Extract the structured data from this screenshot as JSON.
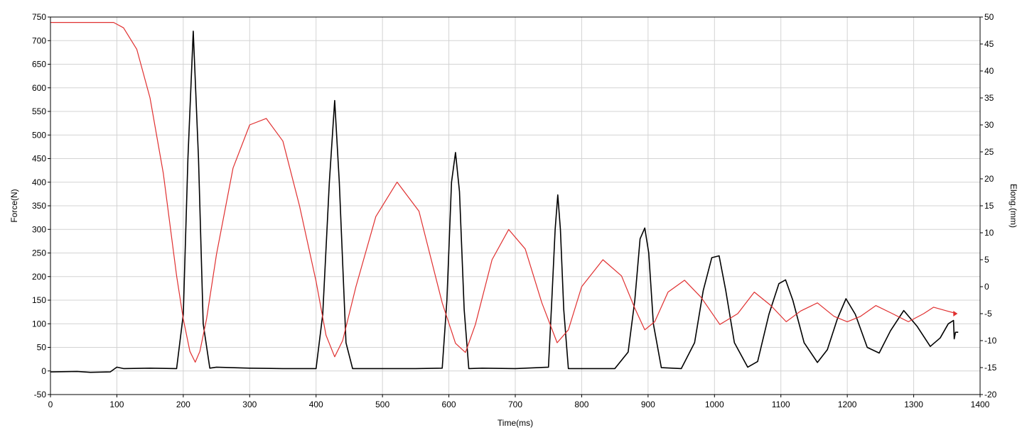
{
  "chart_data": {
    "type": "line",
    "xlabel": "Time(ms)",
    "ylabel_left": "Force(N)",
    "ylabel_right": "Elong.(mm)",
    "xlim": [
      0,
      1400
    ],
    "ylim_left": [
      -50,
      750
    ],
    "ylim_right": [
      -20,
      50
    ],
    "x_ticks": [
      0,
      100,
      200,
      300,
      400,
      500,
      600,
      700,
      800,
      900,
      1000,
      1100,
      1200,
      1300,
      1400
    ],
    "y_left_ticks": [
      -50,
      0,
      50,
      100,
      150,
      200,
      250,
      300,
      350,
      400,
      450,
      500,
      550,
      600,
      650,
      700,
      750
    ],
    "y_right_ticks": [
      -20,
      -15,
      -10,
      -5,
      0,
      5,
      10,
      15,
      20,
      25,
      30,
      35,
      40,
      45,
      50
    ],
    "grid": true,
    "legend": "none",
    "series": [
      {
        "axis": "left",
        "color": "#000000",
        "x": [
          0,
          40,
          60,
          90,
          100,
          110,
          150,
          190,
          200,
          207,
          215,
          223,
          230,
          240,
          250,
          300,
          350,
          400,
          410,
          420,
          428,
          435,
          445,
          455,
          500,
          550,
          590,
          597,
          604,
          610,
          616,
          623,
          630,
          650,
          700,
          750,
          755,
          760,
          764,
          768,
          773,
          780,
          800,
          850,
          870,
          880,
          888,
          895,
          901,
          908,
          920,
          950,
          970,
          983,
          996,
          1007,
          1017,
          1030,
          1050,
          1065,
          1082,
          1097,
          1107,
          1118,
          1135,
          1155,
          1170,
          1185,
          1198,
          1212,
          1230,
          1248,
          1265,
          1285,
          1305,
          1325,
          1340,
          1352,
          1360,
          1361,
          1363,
          1367
        ],
        "y": [
          -2,
          -1,
          -3,
          -2,
          8,
          5,
          6,
          5,
          120,
          450,
          720,
          450,
          100,
          6,
          8,
          6,
          5,
          5,
          120,
          400,
          573,
          400,
          60,
          5,
          5,
          5,
          6,
          150,
          400,
          463,
          380,
          130,
          5,
          6,
          5,
          8,
          150,
          300,
          373,
          300,
          130,
          5,
          5,
          5,
          40,
          150,
          280,
          303,
          250,
          100,
          7,
          5,
          60,
          170,
          240,
          244,
          170,
          60,
          8,
          20,
          120,
          185,
          193,
          150,
          60,
          18,
          45,
          110,
          153,
          120,
          50,
          38,
          85,
          128,
          95,
          52,
          70,
          100,
          107,
          68,
          82,
          82
        ]
      },
      {
        "axis": "right",
        "color": "#e03030",
        "x": [
          0,
          50,
          95,
          110,
          130,
          150,
          170,
          190,
          200,
          210,
          218,
          225,
          235,
          250,
          275,
          300,
          325,
          350,
          375,
          400,
          415,
          428,
          440,
          460,
          490,
          522,
          555,
          590,
          610,
          625,
          640,
          665,
          690,
          715,
          740,
          763,
          780,
          800,
          832,
          860,
          880,
          895,
          910,
          930,
          955,
          980,
          1008,
          1035,
          1060,
          1085,
          1108,
          1130,
          1155,
          1180,
          1200,
          1220,
          1243,
          1268,
          1292,
          1315,
          1330,
          1350,
          1365
        ],
        "y": [
          49,
          49,
          49,
          48,
          44,
          35,
          21,
          2,
          -6,
          -12,
          -14,
          -12,
          -6,
          6,
          22,
          30,
          31.2,
          27,
          15,
          1,
          -9,
          -13,
          -10,
          0,
          13,
          19.4,
          14,
          -3,
          -10.5,
          -12.2,
          -7,
          5,
          10.6,
          7,
          -3,
          -10.4,
          -8,
          0,
          5,
          2,
          -4,
          -8,
          -6.5,
          -1,
          1.2,
          -2,
          -7,
          -5,
          -1,
          -3.5,
          -6.5,
          -4.5,
          -3,
          -5.5,
          -6.5,
          -5.5,
          -3.5,
          -5,
          -6.5,
          -5,
          -3.8,
          -4.5,
          -5
        ]
      }
    ]
  }
}
